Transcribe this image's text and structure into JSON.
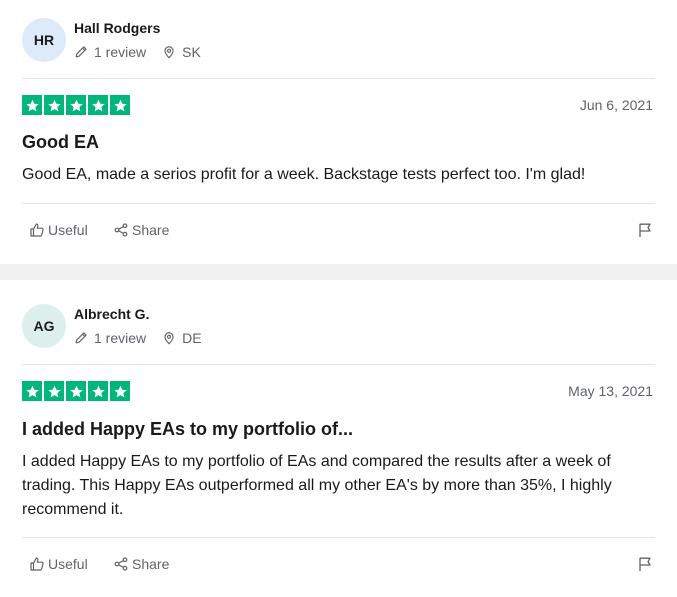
{
  "colors": {
    "star_green": "#00b67a",
    "avatar_1": "#dceaf9",
    "avatar_2": "#dcefeb",
    "separator": "#f1f1f2",
    "muted_text": "#5f6368"
  },
  "icons": {
    "review_count": "pencil-icon",
    "location": "location-pin-icon",
    "rating": "star-icon",
    "useful": "thumbs-up-icon",
    "share": "share-icon",
    "report": "flag-icon"
  },
  "reviews": [
    {
      "initials": "HR",
      "name": "Hall Rodgers",
      "review_count": "1 review",
      "country": "SK",
      "rating": 5,
      "date": "Jun 6, 2021",
      "title": "Good EA",
      "body": "Good EA, made a serios profit for a week. Backstage tests perfect too. I'm glad!",
      "useful_label": "Useful",
      "share_label": "Share"
    },
    {
      "initials": "AG",
      "name": "Albrecht G.",
      "review_count": "1 review",
      "country": "DE",
      "rating": 5,
      "date": "May 13, 2021",
      "title": "I added Happy EAs to my portfolio of...",
      "body": "I added Happy EAs to my portfolio of EAs and compared the results after a week of trading. This Happy EAs outperformed all my other EA's by more than 35%, I highly recommend it.",
      "useful_label": "Useful",
      "share_label": "Share"
    }
  ]
}
